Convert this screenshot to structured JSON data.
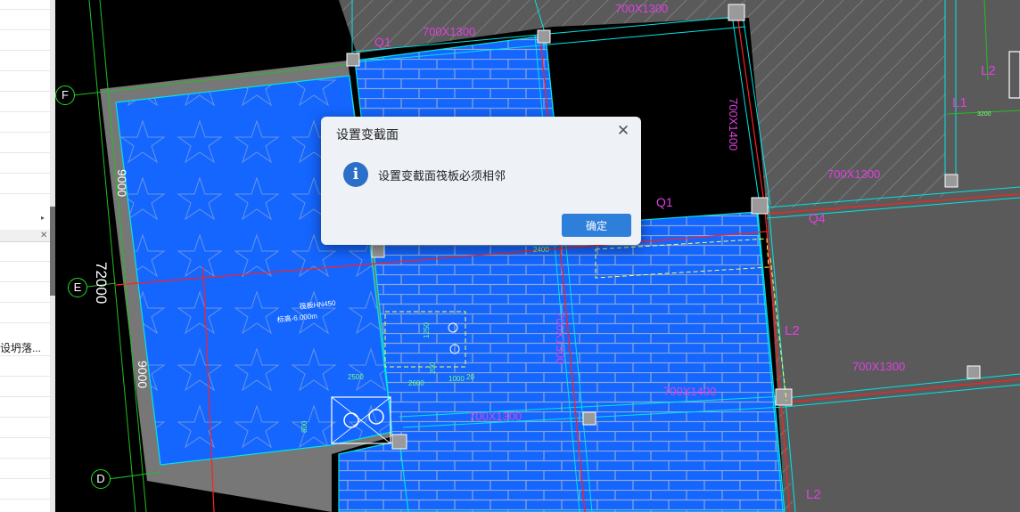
{
  "dialog": {
    "title": "设置变截面",
    "message": "设置变截面筏板必须相邻",
    "ok_label": "确定",
    "close_glyph": "✕",
    "info_glyph": "i"
  },
  "left_panel": {
    "truncated_text": "设坍落...",
    "expand_glyph": "▸",
    "close_glyph": "✕"
  },
  "axes": {
    "F": "F",
    "E": "E",
    "D": "D"
  },
  "dimensions": {
    "total": "72000",
    "upper": "9000",
    "lower": "9000",
    "d2500": "2500",
    "d2600": "2600",
    "d1000": "1000",
    "d20": "20",
    "d2400": "2400",
    "d3200": "3200",
    "d1250": "1250",
    "d200": "200",
    "d800": "800"
  },
  "beam_labels": {
    "b1": "700X1300",
    "b2": "700X1300",
    "b3": "700X1300",
    "b4": "700X1300",
    "b5": "700X1400",
    "b6": "700X1300",
    "b7": "700X1400",
    "b8": "700X1300"
  },
  "region_labels": {
    "q1": "Q1",
    "q2": "Q1",
    "q3": "Q4",
    "l1": "L1",
    "l2": "L2",
    "l3": "L2",
    "l4": "L2"
  },
  "slab_notes": {
    "n1": "筏板HN450",
    "n2": "标高-6.000m"
  },
  "colors": {
    "canvas_bg": "#000000",
    "slab_blue": "#1466ff",
    "gray_area": "#5a5a5a",
    "beam_cyan": "#00e5e5",
    "axis_red": "#ff2020",
    "text_magenta": "#e040e0",
    "dialog_button": "#2e7fd9",
    "info_icon": "#2c6fc9"
  }
}
